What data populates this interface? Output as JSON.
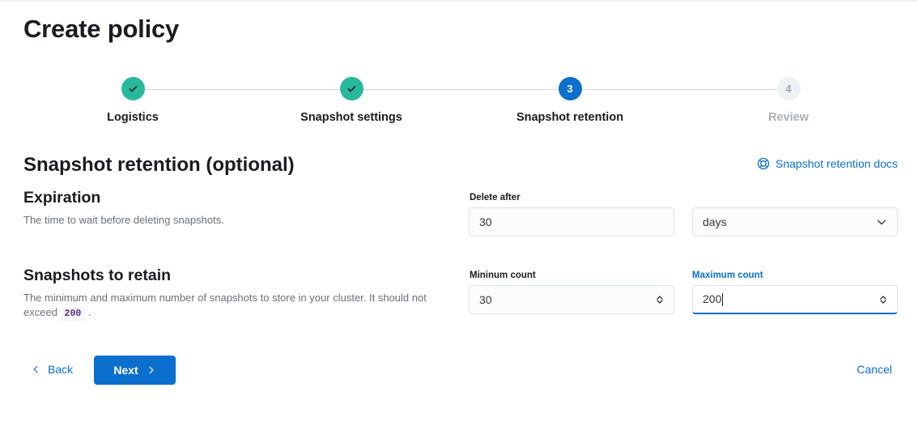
{
  "page": {
    "title": "Create policy"
  },
  "steps": [
    {
      "label": "Logistics",
      "status": "complete",
      "number": "1"
    },
    {
      "label": "Snapshot settings",
      "status": "complete",
      "number": "2"
    },
    {
      "label": "Snapshot retention",
      "status": "current",
      "number": "3"
    },
    {
      "label": "Review",
      "status": "incomplete",
      "number": "4"
    }
  ],
  "section": {
    "title": "Snapshot retention (optional)",
    "docs_link": "Snapshot retention docs",
    "docs_icon": "help-circle-icon"
  },
  "expiration": {
    "title": "Expiration",
    "description": "The time to wait before deleting snapshots.",
    "delete_after_label": "Delete after",
    "delete_after_value": "30",
    "unit_value": "days"
  },
  "retain": {
    "title": "Snapshots to retain",
    "description": "The minimum and maximum number of snapshots to store in your cluster. It should not exceed",
    "description_code": "200",
    "description_end": ".",
    "min_label": "Mininum count",
    "min_value": "30",
    "max_label": "Maximum count",
    "max_value": "200"
  },
  "actions": {
    "back": "Back",
    "next": "Next",
    "cancel": "Cancel"
  },
  "colors": {
    "primary": "#0b6fcd",
    "success": "#27b99c",
    "text": "#1a1c21",
    "subdued": "#69707d"
  }
}
